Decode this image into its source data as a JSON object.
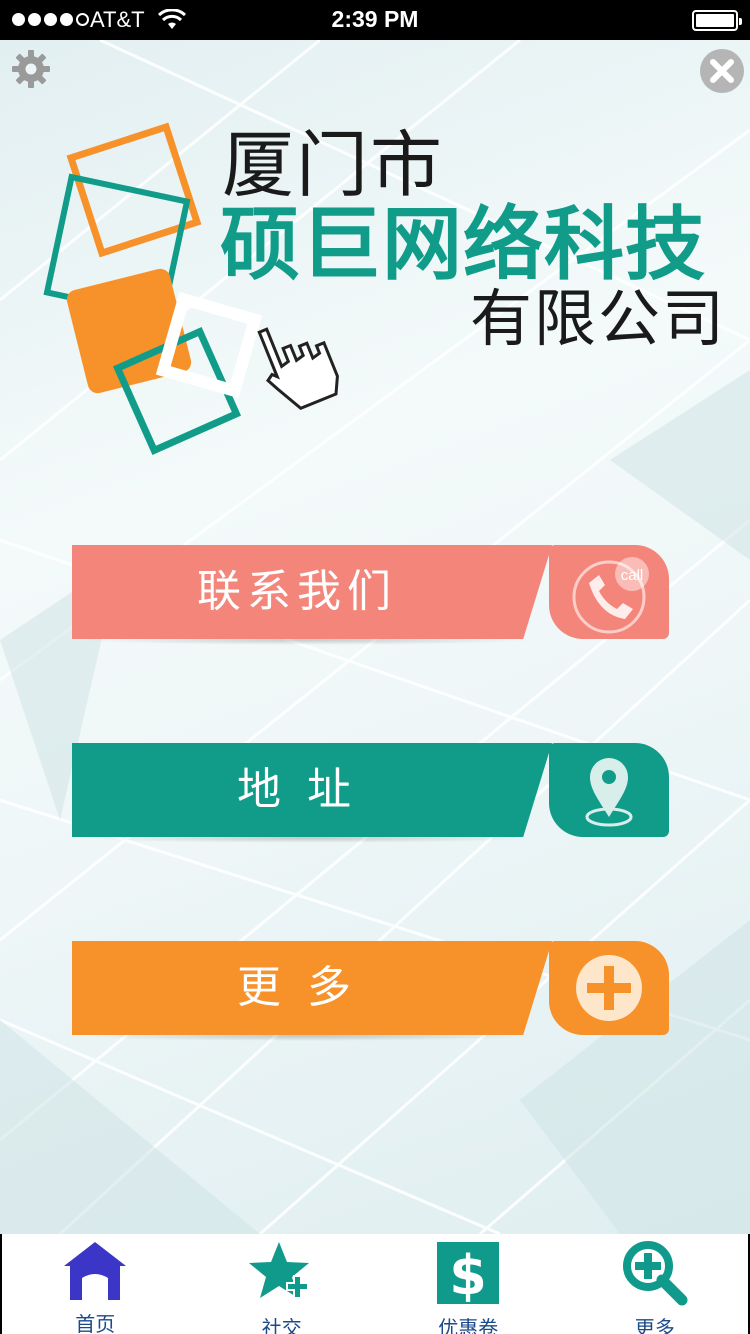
{
  "status_bar": {
    "carrier": "AT&T",
    "time": "2:39 PM"
  },
  "logo": {
    "line1": "厦门市",
    "line2": "硕巨网络科技",
    "line3": "有限公司"
  },
  "menu": [
    {
      "label": "联系我们",
      "badge": "call",
      "color": "#f4857a",
      "tab_color": "#f4857a"
    },
    {
      "label": "地 址",
      "color": "#119c8a",
      "tab_color": "#119c8a"
    },
    {
      "label": "更 多",
      "color": "#f7922a",
      "tab_color": "#f7922a"
    }
  ],
  "tabbar": [
    {
      "label": "首页",
      "icon": "home-icon",
      "color": "#3b35c8"
    },
    {
      "label": "社交",
      "icon": "star-plus-icon",
      "color": "#0f9a8c"
    },
    {
      "label": "优惠卷",
      "icon": "dollar-icon",
      "color": "#0f9a8c"
    },
    {
      "label": "更多",
      "icon": "search-plus-icon",
      "color": "#0f9a8c"
    }
  ]
}
